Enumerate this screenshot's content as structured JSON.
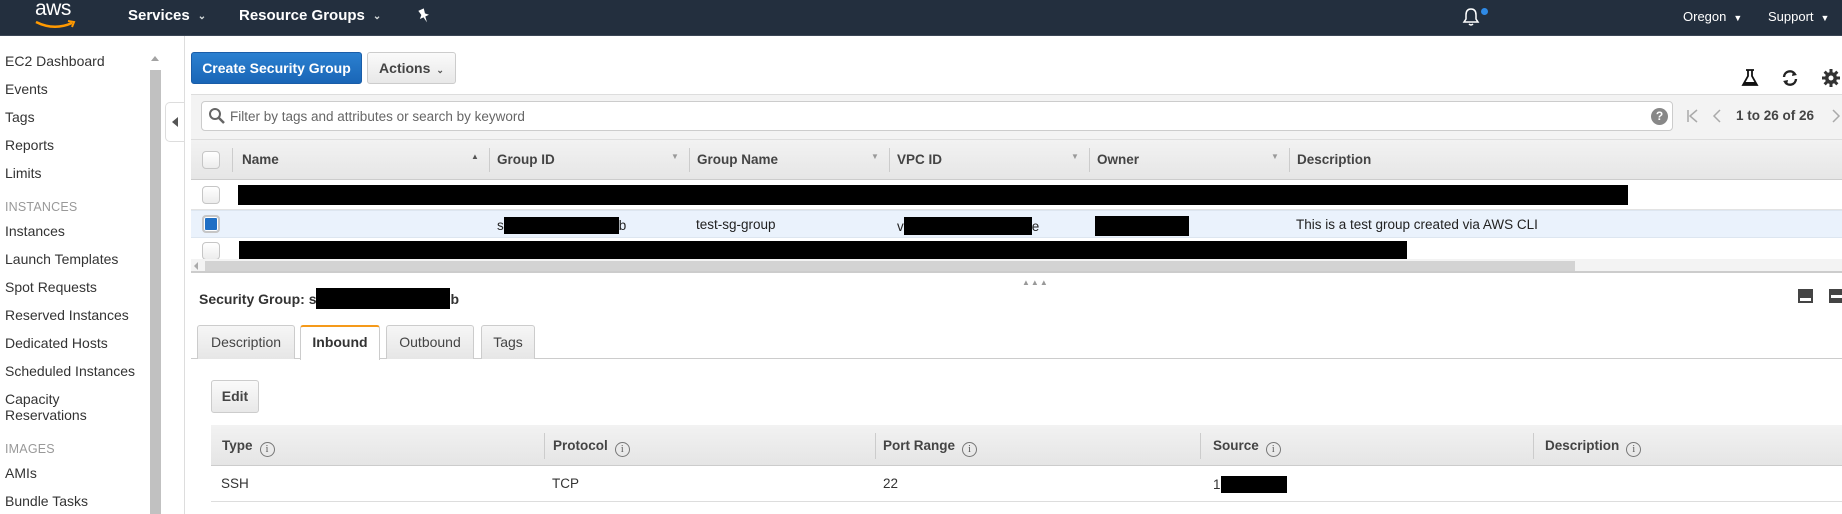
{
  "topnav": {
    "logo": "aws",
    "services": "Services",
    "resource_groups": "Resource Groups",
    "region": "Oregon",
    "support": "Support",
    "colors": {
      "bg": "#232f3e",
      "logo_smile": "#ff9900",
      "notification_dot": "#2e8ae6"
    }
  },
  "sidebar": {
    "items": [
      {
        "label": "EC2 Dashboard"
      },
      {
        "label": "Events"
      },
      {
        "label": "Tags"
      },
      {
        "label": "Reports"
      },
      {
        "label": "Limits"
      }
    ],
    "sections": [
      {
        "heading": "INSTANCES",
        "items": [
          "Instances",
          "Launch Templates",
          "Spot Requests",
          "Reserved Instances",
          "Dedicated Hosts",
          "Scheduled Instances",
          "Capacity Reservations"
        ]
      },
      {
        "heading": "IMAGES",
        "items": [
          "AMIs",
          "Bundle Tasks"
        ]
      }
    ]
  },
  "toolbar": {
    "create_label": "Create Security Group",
    "actions_label": "Actions",
    "primary_color": "#1f6fc5"
  },
  "filter": {
    "placeholder": "Filter by tags and attributes or search by keyword",
    "value": "",
    "help": "?",
    "pagination": "1 to 26 of 26"
  },
  "table": {
    "columns": [
      "Name",
      "Group ID",
      "Group Name",
      "VPC ID",
      "Owner",
      "Description"
    ],
    "rows": [
      {
        "selected": false,
        "redacted": true
      },
      {
        "selected": true,
        "name": "",
        "group_id_prefix": "s",
        "group_id_suffix": "b",
        "group_name": "test-sg-group",
        "vpc_id_prefix": "v",
        "vpc_id_suffix": "e",
        "owner": "",
        "description": "This is a test group created via AWS CLI"
      },
      {
        "selected": false,
        "redacted": true
      }
    ]
  },
  "details": {
    "label": "Security Group:",
    "id_prefix": "s",
    "id_suffix": "b",
    "tabs": [
      {
        "label": "Description",
        "active": false
      },
      {
        "label": "Inbound",
        "active": true
      },
      {
        "label": "Outbound",
        "active": false
      },
      {
        "label": "Tags",
        "active": false
      }
    ],
    "edit_label": "Edit",
    "rules": {
      "columns": [
        "Type",
        "Protocol",
        "Port Range",
        "Source",
        "Description"
      ],
      "rows": [
        {
          "type": "SSH",
          "protocol": "TCP",
          "port_range": "22",
          "source_prefix": "1",
          "description": ""
        }
      ]
    },
    "active_tab_color": "#f59a1a"
  }
}
